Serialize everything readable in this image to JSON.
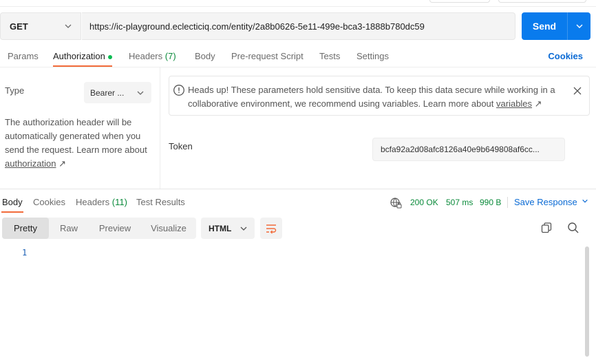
{
  "request": {
    "method": "GET",
    "url": "https://ic-playground.eclecticiq.com/entity/2a8b0626-5e11-499e-bca3-1888b780dc59",
    "send_label": "Send"
  },
  "request_tabs": {
    "params": "Params",
    "authorization": "Authorization",
    "headers": "Headers",
    "headers_count": "(7)",
    "body": "Body",
    "pre_request": "Pre-request Script",
    "tests": "Tests",
    "settings": "Settings",
    "cookies": "Cookies"
  },
  "auth": {
    "type_label": "Type",
    "type_value": "Bearer ...",
    "desc_text": "The authorization header will be automatically generated when you send the request. Learn more about ",
    "desc_link": "authorization",
    "link_arrow": "↗",
    "alert_text": "Heads up! These parameters hold sensitive data. To keep this data secure while working in a collaborative environment, we recommend using variables. Learn more about ",
    "alert_link": "variables",
    "token_label": "Token",
    "token_value": "bcfa92a2d08afc8126a40e9b649808af6cc..."
  },
  "response_tabs": {
    "body": "Body",
    "cookies": "Cookies",
    "headers": "Headers",
    "headers_count": "(11)",
    "test_results": "Test Results"
  },
  "response_status": {
    "status": "200 OK",
    "time": "507 ms",
    "size": "990 B",
    "save_label": "Save Response"
  },
  "body_view": {
    "pretty": "Pretty",
    "raw": "Raw",
    "preview": "Preview",
    "visualize": "Visualize",
    "language": "HTML"
  },
  "code": {
    "line_number": "1"
  },
  "colors": {
    "accent": "#097bed",
    "tab_underline": "#f26b3a",
    "status_green": "#0a8a3a"
  }
}
